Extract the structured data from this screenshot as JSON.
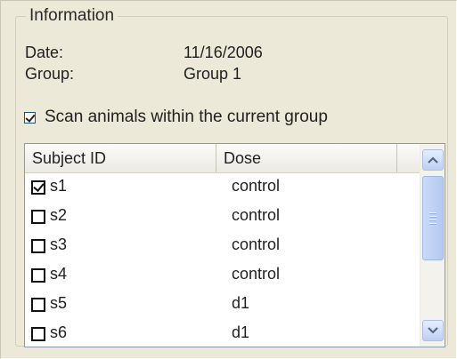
{
  "groupbox": {
    "legend": "Information"
  },
  "info": {
    "date_label": "Date:",
    "date_value": "11/16/2006",
    "group_label": "Group:",
    "group_value": "Group 1"
  },
  "scan_checkbox": {
    "label": "Scan animals within the current group",
    "checked": true
  },
  "table": {
    "columns": [
      "Subject ID",
      "Dose"
    ],
    "rows": [
      {
        "checked": true,
        "subject": "s1",
        "dose": "control"
      },
      {
        "checked": false,
        "subject": "s2",
        "dose": "control"
      },
      {
        "checked": false,
        "subject": "s3",
        "dose": "control"
      },
      {
        "checked": false,
        "subject": "s4",
        "dose": "control"
      },
      {
        "checked": false,
        "subject": "s5",
        "dose": "d1"
      },
      {
        "checked": false,
        "subject": "s6",
        "dose": "d1"
      }
    ]
  },
  "icons": {
    "scroll_up": "chevron-up-icon",
    "scroll_down": "chevron-down-icon"
  },
  "colors": {
    "panel_bg": "#ece9d8",
    "list_border": "#7f9db9",
    "scrollbar_thumb": "#b4c9f2"
  }
}
